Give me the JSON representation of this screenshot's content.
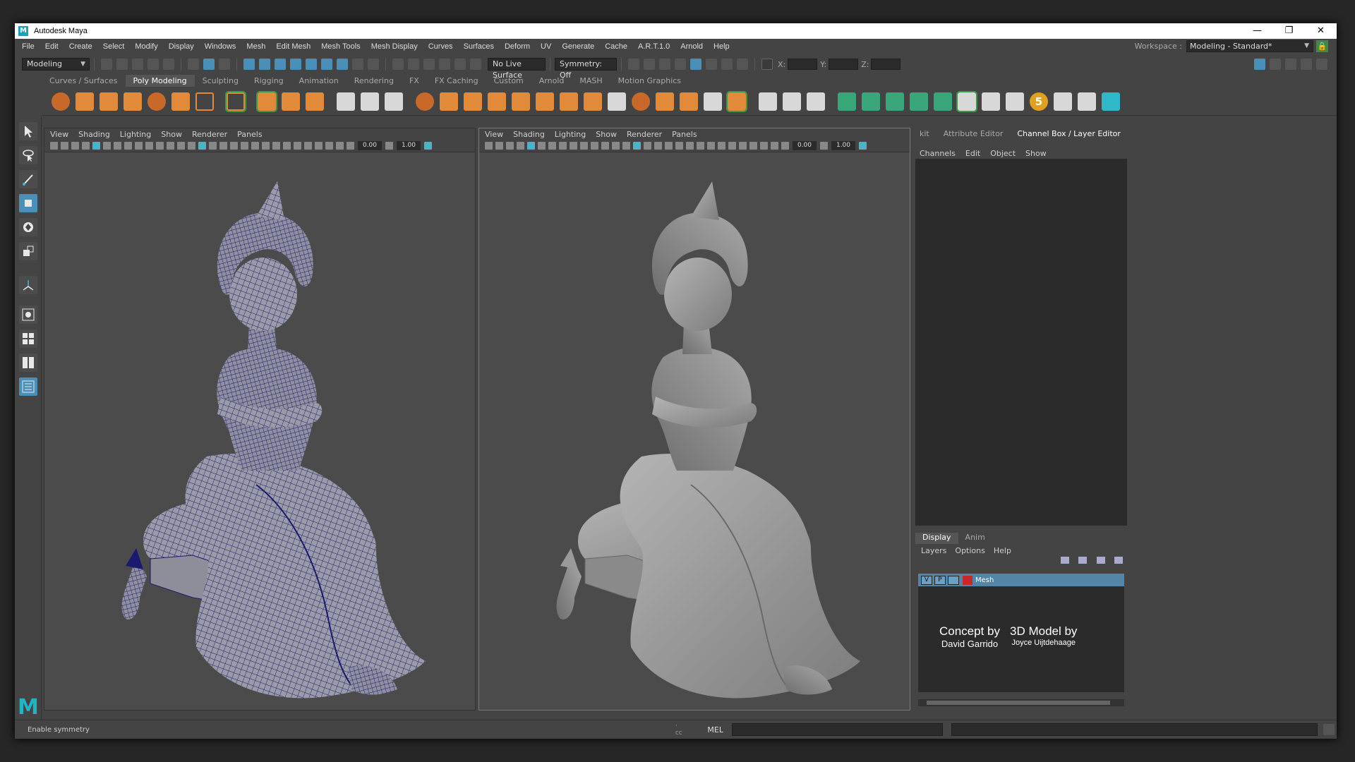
{
  "window": {
    "title": "Autodesk Maya",
    "controls": [
      "—",
      "❐",
      "✕"
    ]
  },
  "menubar": [
    "File",
    "Edit",
    "Create",
    "Select",
    "Modify",
    "Display",
    "Windows",
    "Mesh",
    "Edit Mesh",
    "Mesh Tools",
    "Mesh Display",
    "Curves",
    "Surfaces",
    "Deform",
    "UV",
    "Generate",
    "Cache",
    "A.R.T.1.0",
    "Arnold",
    "Help"
  ],
  "workspace": {
    "label": "Workspace :",
    "value": "Modeling - Standard*"
  },
  "statusline": {
    "mode": "Modeling",
    "live_surface": "No Live Surface",
    "symmetry": "Symmetry: Off",
    "coord_x": "X:",
    "coord_y": "Y:",
    "coord_z": "Z:"
  },
  "shelf_tabs": [
    "Curves / Surfaces",
    "Poly Modeling",
    "Sculpting",
    "Rigging",
    "Animation",
    "Rendering",
    "FX",
    "FX Caching",
    "Custom",
    "Arnold",
    "MASH",
    "Motion Graphics"
  ],
  "shelf_active": "Poly Modeling",
  "viewport_menu": [
    "View",
    "Shading",
    "Lighting",
    "Show",
    "Renderer",
    "Panels"
  ],
  "viewport_values": {
    "field_a": "0.00",
    "field_b": "1.00"
  },
  "right_panel": {
    "tabs": [
      "kit",
      "Attribute Editor",
      "Channel Box / Layer Editor"
    ],
    "active_tab": "Channel Box / Layer Editor",
    "channel_menu": [
      "Channels",
      "Edit",
      "Object",
      "Show"
    ],
    "layer_tabs": [
      "Display",
      "Anim"
    ],
    "layer_menu": [
      "Layers",
      "Options",
      "Help"
    ],
    "layer": {
      "v": "V",
      "p": "P",
      "name": "Mesh",
      "color": "#c8282a"
    }
  },
  "credits": {
    "concept_label": "Concept by",
    "concept_name": "David Garrido",
    "model_label": "3D Model by",
    "model_name": "Joyce Uijtdehaage"
  },
  "helpline": {
    "text": "Enable symmetry",
    "script_tag": "· cc",
    "lang": "MEL"
  },
  "colors": {
    "accent": "#4a8fb8",
    "maya_teal": "#22b3c6",
    "wire": "#1a1a6e"
  }
}
